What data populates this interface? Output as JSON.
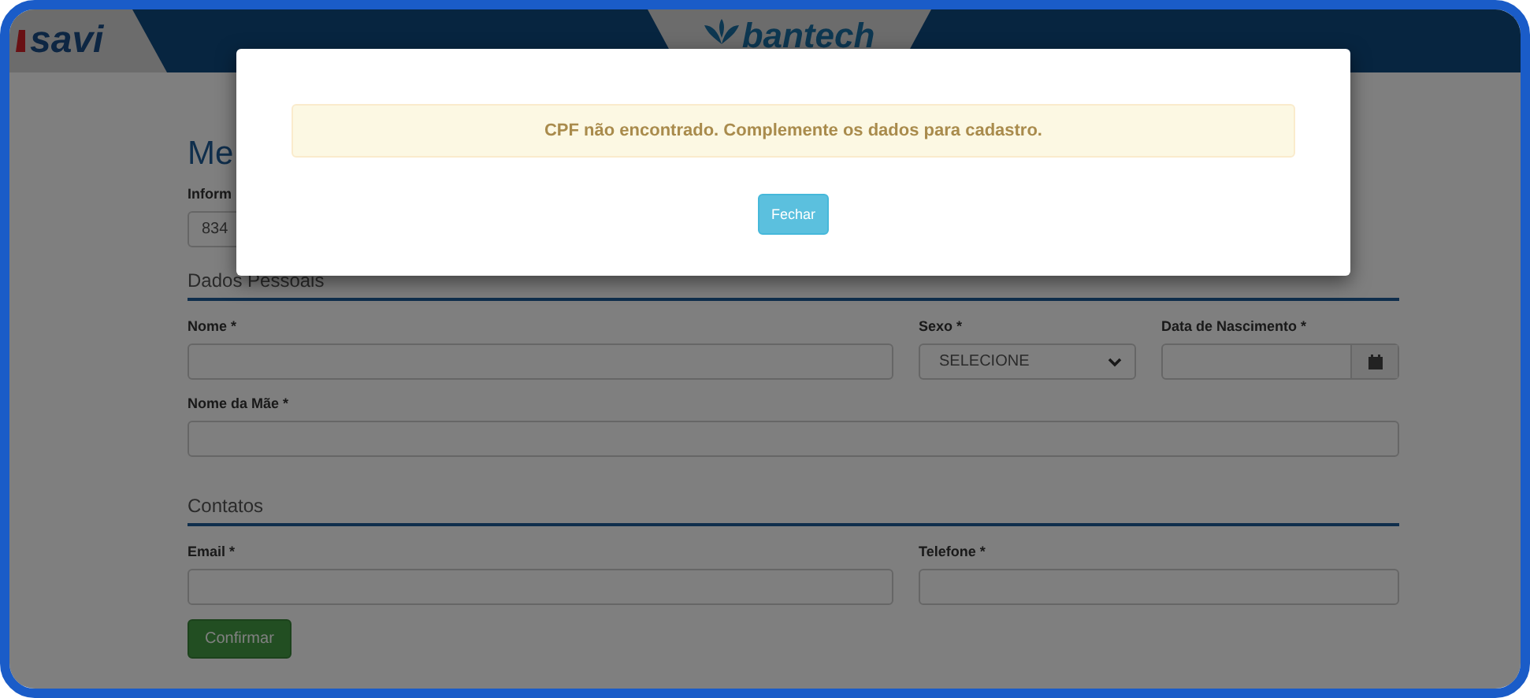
{
  "header": {
    "left_logo": "savi",
    "center_logo": "bantech"
  },
  "page": {
    "title": "Me",
    "cpf_label": "Inform",
    "cpf_value": "834"
  },
  "sections": [
    {
      "title": "Dados Pessoais",
      "rows": [
        [
          {
            "label": "Nome *",
            "kind": "text"
          },
          {
            "label": "Sexo *",
            "kind": "select",
            "value": "SELECIONE"
          },
          {
            "label": "Data de Nascimento *",
            "kind": "date"
          }
        ],
        [
          {
            "label": "Nome da Mãe *",
            "kind": "text"
          }
        ]
      ]
    },
    {
      "title": "Contatos",
      "rows": [
        [
          {
            "label": "Email *",
            "kind": "text"
          },
          {
            "label": "Telefone *",
            "kind": "text"
          }
        ]
      ]
    }
  ],
  "submit": "Confirmar",
  "modal": {
    "message": "CPF não encontrado. Complemente os dados para cadastro.",
    "button": "Fechar"
  }
}
